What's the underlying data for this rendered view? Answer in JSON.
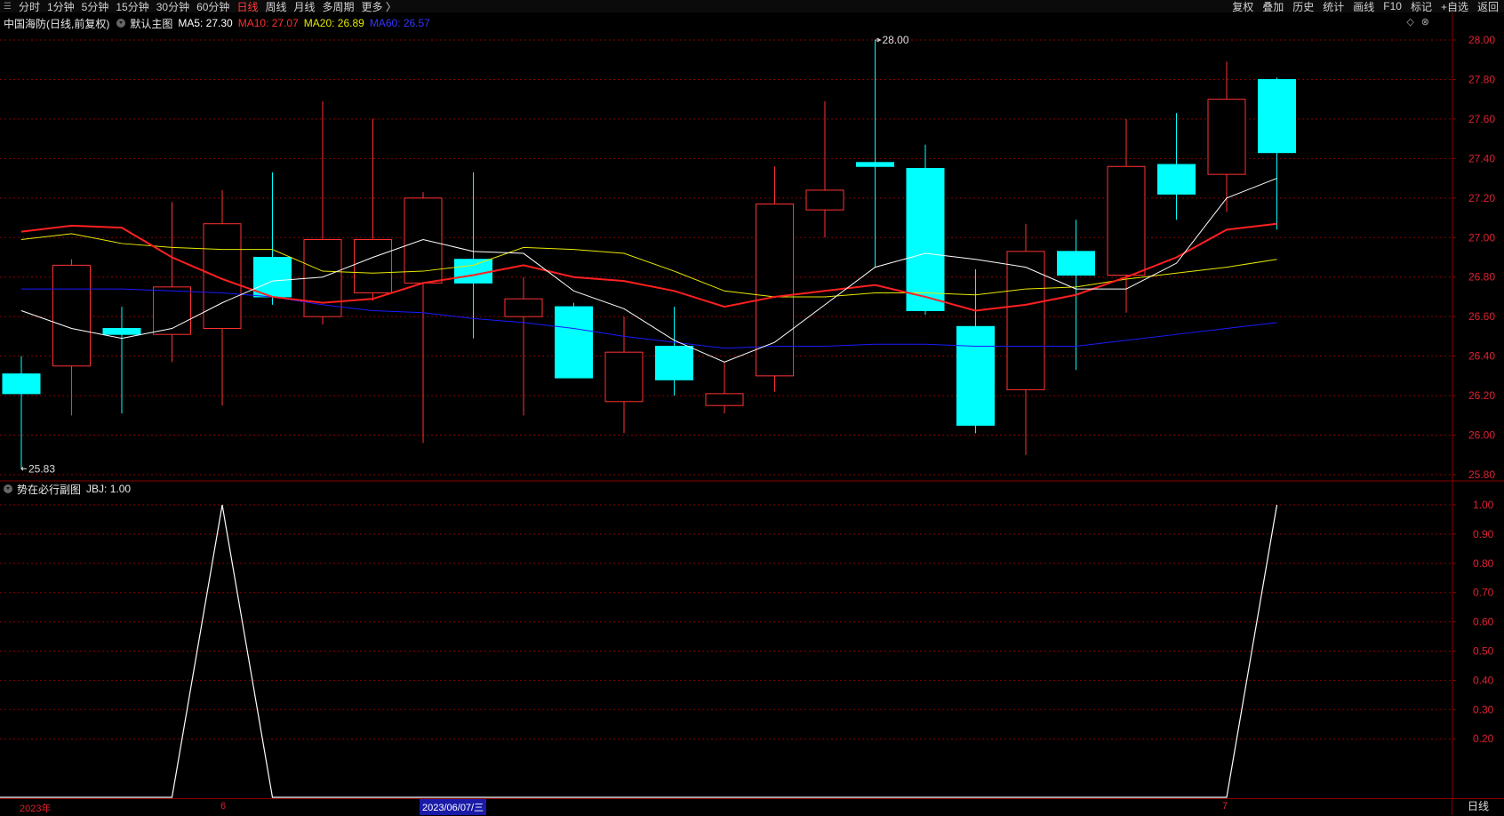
{
  "toolbar": {
    "left_items": [
      "分时",
      "1分钟",
      "5分钟",
      "15分钟",
      "30分钟",
      "60分钟",
      "日线",
      "周线",
      "月线",
      "多周期",
      "更多 〉"
    ],
    "active": "日线",
    "right_items": [
      "复权",
      "叠加",
      "历史",
      "统计",
      "画线",
      "F10",
      "标记",
      "+自选",
      "返回"
    ]
  },
  "main_header": {
    "stock": "中国海防(日线,前复权)",
    "indicator": "默认主图",
    "ma5": "MA5: 27.30",
    "ma10": "MA10: 27.07",
    "ma20": "MA20: 26.89",
    "ma60": "MA60: 26.57"
  },
  "sub_header": {
    "indicator": "势在必行副图",
    "value": "JBJ: 1.00"
  },
  "annotations": {
    "high": "28.00",
    "low": "25.83"
  },
  "price_axis": [
    "28.00",
    "27.80",
    "27.60",
    "27.40",
    "27.20",
    "27.00",
    "26.80",
    "26.60",
    "26.40",
    "26.20",
    "26.00",
    "25.80"
  ],
  "sub_axis": [
    "1.00",
    "0.90",
    "0.80",
    "0.70",
    "0.60",
    "0.50",
    "0.40",
    "0.30",
    "0.20"
  ],
  "bottom": {
    "year": "2023年",
    "m6": "6",
    "cursor_date": "2023/06/07/三",
    "m7": "7",
    "period": "日线"
  },
  "colors": {
    "up": "#ff3232",
    "down": "#00ffff",
    "ma5": "#ffffff",
    "ma10": "#ff2020",
    "ma20": "#e8e800",
    "ma60": "#1a1aff",
    "grid": "#8b0000"
  },
  "chart_data": {
    "type": "candlestick",
    "candles": [
      {
        "o": 26.31,
        "h": 26.4,
        "l": 25.83,
        "c": 26.21
      },
      {
        "o": 26.35,
        "h": 26.89,
        "l": 26.1,
        "c": 26.86
      },
      {
        "o": 26.54,
        "h": 26.65,
        "l": 26.11,
        "c": 26.51
      },
      {
        "o": 26.51,
        "h": 27.18,
        "l": 26.37,
        "c": 26.75
      },
      {
        "o": 26.54,
        "h": 27.24,
        "l": 26.15,
        "c": 27.07
      },
      {
        "o": 26.9,
        "h": 27.33,
        "l": 26.66,
        "c": 26.7
      },
      {
        "o": 26.6,
        "h": 27.69,
        "l": 26.56,
        "c": 26.99
      },
      {
        "o": 26.72,
        "h": 27.6,
        "l": 26.68,
        "c": 26.99
      },
      {
        "o": 26.77,
        "h": 27.23,
        "l": 25.96,
        "c": 27.2
      },
      {
        "o": 26.89,
        "h": 27.33,
        "l": 26.49,
        "c": 26.77
      },
      {
        "o": 26.6,
        "h": 26.8,
        "l": 26.1,
        "c": 26.69
      },
      {
        "o": 26.65,
        "h": 26.67,
        "l": 26.3,
        "c": 26.29
      },
      {
        "o": 26.17,
        "h": 26.6,
        "l": 26.01,
        "c": 26.42
      },
      {
        "o": 26.45,
        "h": 26.65,
        "l": 26.2,
        "c": 26.28
      },
      {
        "o": 26.15,
        "h": 26.37,
        "l": 26.11,
        "c": 26.21
      },
      {
        "o": 26.3,
        "h": 27.36,
        "l": 26.22,
        "c": 27.17
      },
      {
        "o": 27.14,
        "h": 27.69,
        "l": 27.0,
        "c": 27.24
      },
      {
        "o": 27.38,
        "h": 28.0,
        "l": 26.85,
        "c": 27.36
      },
      {
        "o": 27.35,
        "h": 27.47,
        "l": 26.61,
        "c": 26.63
      },
      {
        "o": 26.55,
        "h": 26.84,
        "l": 26.01,
        "c": 26.05
      },
      {
        "o": 26.23,
        "h": 27.07,
        "l": 25.9,
        "c": 26.93
      },
      {
        "o": 26.93,
        "h": 27.09,
        "l": 26.33,
        "c": 26.81
      },
      {
        "o": 26.81,
        "h": 27.6,
        "l": 26.62,
        "c": 27.36
      },
      {
        "o": 27.37,
        "h": 27.63,
        "l": 27.09,
        "c": 27.22
      },
      {
        "o": 27.32,
        "h": 27.89,
        "l": 27.13,
        "c": 27.7
      },
      {
        "o": 27.8,
        "h": 27.81,
        "l": 27.04,
        "c": 27.43
      }
    ],
    "ma5": [
      26.63,
      26.54,
      26.49,
      26.54,
      26.67,
      26.78,
      26.8,
      26.9,
      26.99,
      26.93,
      26.92,
      26.73,
      26.64,
      26.48,
      26.37,
      26.47,
      26.66,
      26.85,
      26.92,
      26.89,
      26.85,
      26.74,
      26.74,
      26.87,
      27.2,
      27.3
    ],
    "ma10": [
      27.03,
      27.06,
      27.05,
      26.9,
      26.79,
      26.7,
      26.67,
      26.69,
      26.77,
      26.81,
      26.86,
      26.8,
      26.78,
      26.73,
      26.65,
      26.7,
      26.73,
      26.76,
      26.7,
      26.63,
      26.66,
      26.71,
      26.8,
      26.9,
      27.04,
      27.07
    ],
    "ma20": [
      26.99,
      27.02,
      26.97,
      26.95,
      26.94,
      26.94,
      26.83,
      26.82,
      26.83,
      26.86,
      26.95,
      26.94,
      26.92,
      26.83,
      26.73,
      26.7,
      26.7,
      26.72,
      26.72,
      26.71,
      26.74,
      26.75,
      26.79,
      26.82,
      26.85,
      26.89
    ],
    "ma60": [
      26.74,
      26.74,
      26.74,
      26.73,
      26.72,
      26.7,
      26.66,
      26.63,
      26.62,
      26.59,
      26.57,
      26.54,
      26.5,
      26.47,
      26.44,
      26.45,
      26.45,
      26.46,
      26.46,
      26.45,
      26.45,
      26.45,
      26.48,
      26.51,
      26.54,
      26.57
    ],
    "jbj": [
      0,
      0,
      0,
      0,
      1,
      0,
      0,
      0,
      0,
      0,
      0,
      0,
      0,
      0,
      0,
      0,
      0,
      0,
      0,
      0,
      0,
      0,
      0,
      0,
      0,
      1
    ],
    "ylim": [
      25.75,
      28.05
    ],
    "sub_ylim": [
      0,
      1.0
    ]
  }
}
